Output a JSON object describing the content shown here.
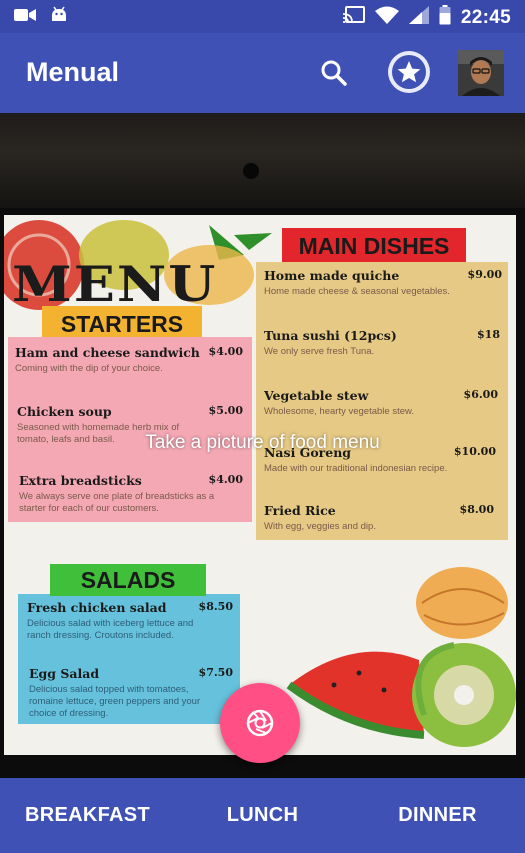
{
  "status_bar": {
    "time": "22:45",
    "icons": [
      "video-camera-icon",
      "android-debug-icon",
      "cast-icon",
      "wifi-icon",
      "signal-icon",
      "battery-icon"
    ]
  },
  "app_bar": {
    "title": "Menual",
    "actions": [
      "search-icon",
      "star-icon",
      "avatar"
    ]
  },
  "camera_preview": {
    "hint": "Take a picture of food menu",
    "menu_photo": {
      "heading": "MENU",
      "sections": [
        {
          "title": "STARTERS",
          "color": "#f4a8b4",
          "items": [
            {
              "name": "Ham and cheese sandwich",
              "price": "$4.00",
              "description": "Coming with the dip of your choice."
            },
            {
              "name": "Chicken soup",
              "price": "$5.00",
              "description": "Seasoned with homemade herb mix of tomato, leafs and basil."
            },
            {
              "name": "Extra breadsticks",
              "price": "$4.00",
              "description": "We always serve one plate of breadsticks as a starter for each of our customers."
            }
          ]
        },
        {
          "title": "MAIN DISHES",
          "color": "#e6c984",
          "items": [
            {
              "name": "Home made quiche",
              "price": "$9.00",
              "description": "Home made cheese & seasonal vegetables."
            },
            {
              "name": "Tuna sushi (12pcs)",
              "price": "$18",
              "description": "We only serve fresh Tuna."
            },
            {
              "name": "Vegetable stew",
              "price": "$6.00",
              "description": "Wholesome, hearty vegetable stew."
            },
            {
              "name": "Nasi Goreng",
              "price": "$10.00",
              "description": "Made with our traditional indonesian recipe."
            },
            {
              "name": "Fried Rice",
              "price": "$8.00",
              "description": "With egg, veggies and dip."
            }
          ]
        },
        {
          "title": "SALADS",
          "color": "#66c2dc",
          "items": [
            {
              "name": "Fresh chicken salad",
              "price": "$8.50",
              "description": "Delicious salad with iceberg lettuce and ranch dressing. Croutons included."
            },
            {
              "name": "Egg Salad",
              "price": "$7.50",
              "description": "Delicious salad topped with tomatoes, romaine lettuce, green peppers and your choice of dressing."
            }
          ]
        }
      ]
    }
  },
  "capture_button": {
    "icon": "camera-shutter-icon",
    "color": "#ff4f85"
  },
  "bottom_nav": {
    "tabs": [
      {
        "label": "BREAKFAST"
      },
      {
        "label": "LUNCH"
      },
      {
        "label": "DINNER"
      }
    ]
  },
  "colors": {
    "primary": "#3f51b5",
    "status_bar": "#3949ab",
    "accent": "#ff4f85"
  }
}
